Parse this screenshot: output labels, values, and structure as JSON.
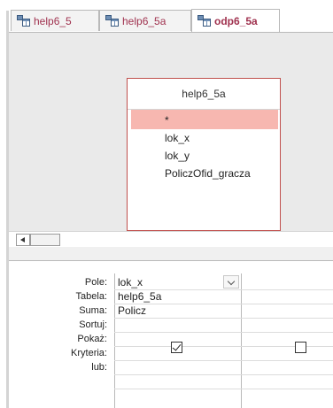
{
  "tabs": [
    {
      "label": "help6_5",
      "active": false
    },
    {
      "label": "help6_5a",
      "active": false
    },
    {
      "label": "odp6_5a",
      "active": true
    }
  ],
  "table_box": {
    "title": "help6_5a",
    "fields": [
      "*",
      "lok_x",
      "lok_y",
      "PoliczOfid_gracza"
    ],
    "selected_field": "*"
  },
  "grid": {
    "row_labels": [
      "Pole:",
      "Tabela:",
      "Suma:",
      "Sortuj:",
      "Pokaż:",
      "Kryteria:",
      "lub:"
    ],
    "columns": [
      {
        "pole": "lok_x",
        "tabela": "help6_5a",
        "suma": "Policz",
        "sortuj": "",
        "pokaz": true
      },
      {
        "pole": "",
        "tabela": "",
        "suma": "",
        "sortuj": "",
        "pokaz": false
      }
    ]
  },
  "colors": {
    "tab_text": "#a0324f",
    "table_border": "#c0504d",
    "selected_field_bg": "#f7b7b0",
    "design_area_bg": "#eaeaea"
  },
  "icons": {
    "tab_icon": "query-icon",
    "scroll_left": "arrow-left-icon",
    "dropdown": "chevron-down-icon",
    "checkbox": "checkbox-icon"
  }
}
